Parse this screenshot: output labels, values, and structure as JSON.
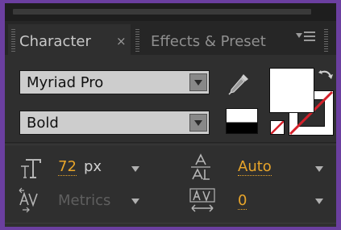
{
  "tabs": {
    "active_label": "Character",
    "active_close": "×",
    "inactive_label": "Effects & Preset"
  },
  "font": {
    "family": "Myriad Pro",
    "style": "Bold"
  },
  "metrics": {
    "font_size_value": "72",
    "font_size_unit": "px",
    "leading_value": "Auto",
    "kerning_value": "Metrics",
    "tracking_value": "0"
  },
  "colors": {
    "panel_bg": "#2f2f2f",
    "value_orange": "#e8a52a",
    "fill_color": "#ffffff",
    "no_color_slash": "#d4202a"
  },
  "icons": [
    "eyedropper-icon",
    "swap-colors-icon",
    "font-size-icon",
    "leading-icon",
    "kerning-icon",
    "tracking-icon",
    "panel-menu-icon"
  ]
}
